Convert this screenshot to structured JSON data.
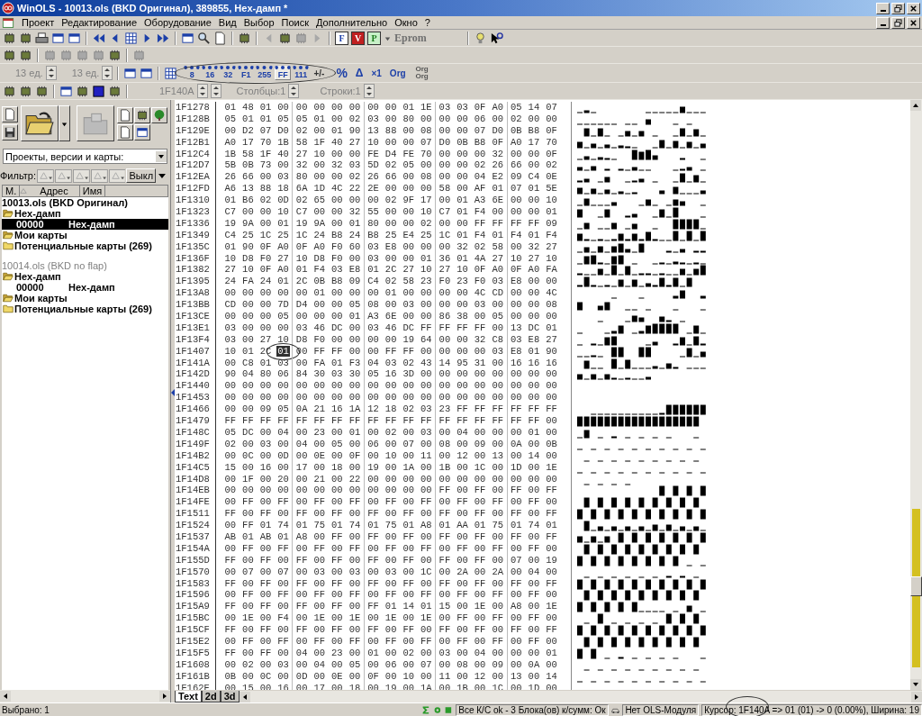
{
  "window": {
    "title": "WinOLS - 10013.ols (BKD Оригинал), 389855, Hex-дамп *"
  },
  "menu": [
    "Проект",
    "Редактирование",
    "Оборудование",
    "Вид",
    "Выбор",
    "Поиск",
    "Дополнительно",
    "Окно",
    "?"
  ],
  "toolbar": {
    "version_buttons": [
      "F",
      "V",
      "P"
    ],
    "eprom": "Eprom"
  },
  "format_toolbar": {
    "spinners": [
      "13 ед.",
      "13 ед."
    ],
    "width_buttons": [
      {
        "label": "8",
        "selected": false
      },
      {
        "label": "16",
        "selected": false
      },
      {
        "label": "32",
        "selected": false
      },
      {
        "label": "F1",
        "selected": false
      }
    ],
    "display_buttons": [
      {
        "label": "255",
        "selected": false
      },
      {
        "label": "FF",
        "selected": true
      },
      {
        "label": "111",
        "selected": false
      }
    ],
    "sign_button": "+/-",
    "mode_buttons": [
      "%",
      "Δ",
      "×1",
      "Org"
    ],
    "org_pair": [
      "Org",
      "Org"
    ]
  },
  "position_toolbar": {
    "address": "1F140A",
    "columns": "Столбцы:1",
    "rows": "Строки:1"
  },
  "left_panel": {
    "combo": "Проекты, версии и карты:",
    "filter_label": "Фильтр:",
    "filter_off": "Выкл",
    "columns": [
      "М.",
      "Адрес",
      "Имя"
    ],
    "projects": [
      {
        "name": "10013.ols (BKD Оригинал)",
        "active": true,
        "folders": [
          {
            "name": "Hex-дамп",
            "expanded": true,
            "maps": [
              {
                "address": "00000",
                "name": "Hex-дамп",
                "selected": true
              }
            ]
          },
          {
            "name": "Мои карты",
            "expanded": true
          },
          {
            "name": "Потенциальные карты (269)",
            "expanded": false
          }
        ]
      },
      {
        "name": "10014.ols (BKD no flap)",
        "active": false,
        "folders": [
          {
            "name": "Hex-дамп",
            "expanded": true,
            "maps": [
              {
                "address": "00000",
                "name": "Hex-дамп",
                "selected": false
              }
            ]
          },
          {
            "name": "Мои карты",
            "expanded": true
          },
          {
            "name": "Потенциальные карты (269)",
            "expanded": false
          }
        ]
      }
    ]
  },
  "hex_view": {
    "rows": [
      {
        "address": "1F1278",
        "bytes": [
          "01",
          "48",
          "01",
          "00",
          "00",
          "00",
          "00",
          "00",
          "00",
          "00",
          "01",
          "1E",
          "03",
          "03",
          "0F",
          "A0",
          "05",
          "14",
          "07"
        ]
      },
      {
        "address": "1F128B",
        "bytes": [
          "05",
          "01",
          "01",
          "05",
          "05",
          "01",
          "00",
          "02",
          "03",
          "00",
          "80",
          "00",
          "00",
          "00",
          "06",
          "00",
          "02",
          "00",
          "00"
        ]
      },
      {
        "address": "1F129E",
        "bytes": [
          "00",
          "D2",
          "07",
          "D0",
          "02",
          "00",
          "01",
          "90",
          "13",
          "88",
          "00",
          "08",
          "00",
          "00",
          "07",
          "D0",
          "0B",
          "B8",
          "0F"
        ]
      },
      {
        "address": "1F12B1",
        "bytes": [
          "A0",
          "17",
          "70",
          "1B",
          "58",
          "1F",
          "40",
          "27",
          "10",
          "00",
          "00",
          "07",
          "D0",
          "0B",
          "B8",
          "0F",
          "A0",
          "17",
          "70"
        ]
      },
      {
        "address": "1F12C4",
        "bytes": [
          "1B",
          "58",
          "1F",
          "40",
          "27",
          "10",
          "00",
          "00",
          "FE",
          "D4",
          "FE",
          "70",
          "00",
          "00",
          "00",
          "32",
          "00",
          "00",
          "0F"
        ]
      },
      {
        "address": "1F12D7",
        "bytes": [
          "5B",
          "0B",
          "73",
          "00",
          "32",
          "00",
          "32",
          "03",
          "5D",
          "02",
          "05",
          "00",
          "00",
          "00",
          "02",
          "26",
          "66",
          "00",
          "02"
        ]
      },
      {
        "address": "1F12EA",
        "bytes": [
          "26",
          "66",
          "00",
          "03",
          "80",
          "00",
          "00",
          "02",
          "26",
          "66",
          "00",
          "08",
          "00",
          "00",
          "04",
          "E2",
          "09",
          "C4",
          "0E"
        ]
      },
      {
        "address": "1F12FD",
        "bytes": [
          "A6",
          "13",
          "88",
          "18",
          "6A",
          "1D",
          "4C",
          "22",
          "2E",
          "00",
          "00",
          "00",
          "58",
          "00",
          "AF",
          "01",
          "07",
          "01",
          "5E"
        ]
      },
      {
        "address": "1F1310",
        "bytes": [
          "01",
          "B6",
          "02",
          "0D",
          "02",
          "65",
          "00",
          "00",
          "00",
          "02",
          "9F",
          "17",
          "00",
          "01",
          "A3",
          "6E",
          "00",
          "00",
          "10"
        ]
      },
      {
        "address": "1F1323",
        "bytes": [
          "C7",
          "00",
          "00",
          "10",
          "C7",
          "00",
          "00",
          "32",
          "55",
          "00",
          "00",
          "10",
          "C7",
          "01",
          "F4",
          "00",
          "00",
          "00",
          "01"
        ]
      },
      {
        "address": "1F1336",
        "bytes": [
          "19",
          "9A",
          "00",
          "01",
          "19",
          "9A",
          "00",
          "01",
          "80",
          "00",
          "00",
          "02",
          "00",
          "00",
          "FF",
          "FF",
          "FF",
          "FF",
          "09"
        ]
      },
      {
        "address": "1F1349",
        "bytes": [
          "C4",
          "25",
          "1C",
          "25",
          "1C",
          "24",
          "B8",
          "24",
          "B8",
          "25",
          "E4",
          "25",
          "1C",
          "01",
          "F4",
          "01",
          "F4",
          "01",
          "F4"
        ]
      },
      {
        "address": "1F135C",
        "bytes": [
          "01",
          "90",
          "0F",
          "A0",
          "0F",
          "A0",
          "F0",
          "60",
          "03",
          "E8",
          "00",
          "00",
          "00",
          "32",
          "02",
          "58",
          "00",
          "32",
          "27"
        ]
      },
      {
        "address": "1F136F",
        "bytes": [
          "10",
          "D8",
          "F0",
          "27",
          "10",
          "D8",
          "F0",
          "00",
          "03",
          "00",
          "00",
          "01",
          "36",
          "01",
          "4A",
          "27",
          "10",
          "27",
          "10"
        ]
      },
      {
        "address": "1F1382",
        "bytes": [
          "27",
          "10",
          "0F",
          "A0",
          "01",
          "F4",
          "03",
          "E8",
          "01",
          "2C",
          "27",
          "10",
          "27",
          "10",
          "0F",
          "A0",
          "0F",
          "A0",
          "FA"
        ]
      },
      {
        "address": "1F1395",
        "bytes": [
          "24",
          "FA",
          "24",
          "01",
          "2C",
          "0B",
          "B8",
          "09",
          "C4",
          "02",
          "58",
          "23",
          "F0",
          "23",
          "F0",
          "03",
          "E8",
          "00",
          "00"
        ]
      },
      {
        "address": "1F13A8",
        "bytes": [
          "00",
          "00",
          "00",
          "00",
          "00",
          "01",
          "00",
          "00",
          "00",
          "01",
          "00",
          "00",
          "00",
          "00",
          "4C",
          "CD",
          "00",
          "00",
          "4C"
        ]
      },
      {
        "address": "1F13BB",
        "bytes": [
          "CD",
          "00",
          "00",
          "7D",
          "D4",
          "00",
          "00",
          "05",
          "08",
          "00",
          "03",
          "00",
          "00",
          "00",
          "03",
          "00",
          "00",
          "00",
          "08"
        ]
      },
      {
        "address": "1F13CE",
        "bytes": [
          "00",
          "00",
          "00",
          "05",
          "00",
          "00",
          "00",
          "01",
          "A3",
          "6E",
          "00",
          "00",
          "86",
          "38",
          "00",
          "05",
          "00",
          "00",
          "00"
        ]
      },
      {
        "address": "1F13E1",
        "bytes": [
          "03",
          "00",
          "00",
          "00",
          "03",
          "46",
          "DC",
          "00",
          "03",
          "46",
          "DC",
          "FF",
          "FF",
          "FF",
          "FF",
          "00",
          "13",
          "DC",
          "01"
        ]
      },
      {
        "address": "1F13F4",
        "bytes": [
          "03",
          "00",
          "27",
          "10",
          "D8",
          "F0",
          "00",
          "00",
          "00",
          "00",
          "19",
          "64",
          "00",
          "00",
          "32",
          "C8",
          "03",
          "E8",
          "27"
        ]
      },
      {
        "address": "1F1407",
        "bytes": [
          "10",
          "01",
          "2C",
          {
            "value": "01",
            "selected": true
          },
          "00",
          "FF",
          "FF",
          "00",
          "00",
          "FF",
          "FF",
          "00",
          "00",
          "00",
          "00",
          "03",
          "E8",
          "01",
          "90"
        ]
      },
      {
        "address": "1F141A",
        "bytes": [
          "00",
          "C8",
          "01",
          "03",
          "00",
          "FA",
          "01",
          "F3",
          "04",
          "03",
          "02",
          "43",
          "14",
          "95",
          "31",
          "00",
          "16",
          "16",
          "16"
        ]
      },
      {
        "address": "1F142D",
        "bytes": [
          "90",
          "04",
          "80",
          "06",
          "84",
          "30",
          "03",
          "30",
          "05",
          "16",
          "3D",
          "00",
          "00",
          "00",
          "00",
          "00",
          "00",
          "00",
          "00"
        ]
      },
      {
        "address": "1F1440",
        "bytes": [
          "00",
          "00",
          "00",
          "00",
          "00",
          "00",
          "00",
          "00",
          "00",
          "00",
          "00",
          "00",
          "00",
          "00",
          "00",
          "00",
          "00",
          "00",
          "00"
        ]
      },
      {
        "address": "1F1453",
        "bytes": [
          "00",
          "00",
          "00",
          "00",
          "00",
          "00",
          "00",
          "00",
          "00",
          "00",
          "00",
          "00",
          "00",
          "00",
          "00",
          "00",
          "00",
          "00",
          "00"
        ]
      },
      {
        "address": "1F1466",
        "bytes": [
          "00",
          "00",
          "09",
          "05",
          "0A",
          "21",
          "16",
          "1A",
          "12",
          "18",
          "02",
          "03",
          "23",
          "FF",
          "FF",
          "FF",
          "FF",
          "FF",
          "FF"
        ]
      },
      {
        "address": "1F1479",
        "bytes": [
          "FF",
          "FF",
          "FF",
          "FF",
          "FF",
          "FF",
          "FF",
          "FF",
          "FF",
          "FF",
          "FF",
          "FF",
          "FF",
          "FF",
          "FF",
          "FF",
          "FF",
          "FF",
          "00"
        ]
      },
      {
        "address": "1F148C",
        "bytes": [
          "05",
          "DC",
          "00",
          "04",
          "00",
          "23",
          "00",
          "01",
          "00",
          "02",
          "00",
          "03",
          "00",
          "04",
          "00",
          "00",
          "00",
          "01",
          "00"
        ]
      },
      {
        "address": "1F149F",
        "bytes": [
          "02",
          "00",
          "03",
          "00",
          "04",
          "00",
          "05",
          "00",
          "06",
          "00",
          "07",
          "00",
          "08",
          "00",
          "09",
          "00",
          "0A",
          "00",
          "0B"
        ]
      },
      {
        "address": "1F14B2",
        "bytes": [
          "00",
          "0C",
          "00",
          "0D",
          "00",
          "0E",
          "00",
          "0F",
          "00",
          "10",
          "00",
          "11",
          "00",
          "12",
          "00",
          "13",
          "00",
          "14",
          "00"
        ]
      },
      {
        "address": "1F14C5",
        "bytes": [
          "15",
          "00",
          "16",
          "00",
          "17",
          "00",
          "18",
          "00",
          "19",
          "00",
          "1A",
          "00",
          "1B",
          "00",
          "1C",
          "00",
          "1D",
          "00",
          "1E"
        ]
      },
      {
        "address": "1F14D8",
        "bytes": [
          "00",
          "1F",
          "00",
          "20",
          "00",
          "21",
          "00",
          "22",
          "00",
          "00",
          "00",
          "00",
          "00",
          "00",
          "00",
          "00",
          "00",
          "00",
          "00"
        ]
      },
      {
        "address": "1F14EB",
        "bytes": [
          "00",
          "00",
          "00",
          "00",
          "00",
          "00",
          "00",
          "00",
          "00",
          "00",
          "00",
          "00",
          "FF",
          "00",
          "FF",
          "00",
          "FF",
          "00",
          "FF"
        ]
      },
      {
        "address": "1F14FE",
        "bytes": [
          "00",
          "FF",
          "00",
          "FF",
          "00",
          "FF",
          "00",
          "FF",
          "00",
          "FF",
          "00",
          "FF",
          "00",
          "FF",
          "00",
          "FF",
          "00",
          "FF",
          "00"
        ]
      },
      {
        "address": "1F1511",
        "bytes": [
          "FF",
          "00",
          "FF",
          "00",
          "FF",
          "00",
          "FF",
          "00",
          "FF",
          "00",
          "FF",
          "00",
          "FF",
          "00",
          "FF",
          "00",
          "FF",
          "00",
          "FF"
        ]
      },
      {
        "address": "1F1524",
        "bytes": [
          "00",
          "FF",
          "01",
          "74",
          "01",
          "75",
          "01",
          "74",
          "01",
          "75",
          "01",
          "A8",
          "01",
          "AA",
          "01",
          "75",
          "01",
          "74",
          "01"
        ]
      },
      {
        "address": "1F1537",
        "bytes": [
          "AB",
          "01",
          "AB",
          "01",
          "A8",
          "00",
          "FF",
          "00",
          "FF",
          "00",
          "FF",
          "00",
          "FF",
          "00",
          "FF",
          "00",
          "FF",
          "00",
          "FF"
        ]
      },
      {
        "address": "1F154A",
        "bytes": [
          "00",
          "FF",
          "00",
          "FF",
          "00",
          "FF",
          "00",
          "FF",
          "00",
          "FF",
          "00",
          "FF",
          "00",
          "FF",
          "00",
          "FF",
          "00",
          "FF",
          "00"
        ]
      },
      {
        "address": "1F155D",
        "bytes": [
          "FF",
          "00",
          "FF",
          "00",
          "FF",
          "00",
          "FF",
          "00",
          "FF",
          "00",
          "FF",
          "00",
          "FF",
          "00",
          "FF",
          "00",
          "07",
          "00",
          "19"
        ]
      },
      {
        "address": "1F1570",
        "bytes": [
          "00",
          "07",
          "00",
          "07",
          "00",
          "03",
          "00",
          "03",
          "00",
          "03",
          "00",
          "1C",
          "00",
          "2A",
          "00",
          "2A",
          "00",
          "04",
          "00"
        ]
      },
      {
        "address": "1F1583",
        "bytes": [
          "FF",
          "00",
          "FF",
          "00",
          "FF",
          "00",
          "FF",
          "00",
          "FF",
          "00",
          "FF",
          "00",
          "FF",
          "00",
          "FF",
          "00",
          "FF",
          "00",
          "FF"
        ]
      },
      {
        "address": "1F1596",
        "bytes": [
          "00",
          "FF",
          "00",
          "FF",
          "00",
          "FF",
          "00",
          "FF",
          "00",
          "FF",
          "00",
          "FF",
          "00",
          "FF",
          "00",
          "FF",
          "00",
          "FF",
          "00"
        ]
      },
      {
        "address": "1F15A9",
        "bytes": [
          "FF",
          "00",
          "FF",
          "00",
          "FF",
          "00",
          "FF",
          "00",
          "FF",
          "01",
          "14",
          "01",
          "15",
          "00",
          "1E",
          "00",
          "A8",
          "00",
          "1E"
        ]
      },
      {
        "address": "1F15BC",
        "bytes": [
          "00",
          "1E",
          "00",
          "F4",
          "00",
          "1E",
          "00",
          "1E",
          "00",
          "1E",
          "00",
          "1E",
          "00",
          "FF",
          "00",
          "FF",
          "00",
          "FF",
          "00"
        ]
      },
      {
        "address": "1F15CF",
        "bytes": [
          "FF",
          "00",
          "FF",
          "00",
          "FF",
          "00",
          "FF",
          "00",
          "FF",
          "00",
          "FF",
          "00",
          "FF",
          "00",
          "FF",
          "00",
          "FF",
          "00",
          "FF"
        ]
      },
      {
        "address": "1F15E2",
        "bytes": [
          "00",
          "FF",
          "00",
          "FF",
          "00",
          "FF",
          "00",
          "FF",
          "00",
          "FF",
          "00",
          "FF",
          "00",
          "FF",
          "00",
          "FF",
          "00",
          "FF",
          "00"
        ]
      },
      {
        "address": "1F15F5",
        "bytes": [
          "FF",
          "00",
          "FF",
          "00",
          "04",
          "00",
          "23",
          "00",
          "01",
          "00",
          "02",
          "00",
          "03",
          "00",
          "04",
          "00",
          "00",
          "00",
          "01"
        ]
      },
      {
        "address": "1F1608",
        "bytes": [
          "00",
          "02",
          "00",
          "03",
          "00",
          "04",
          "00",
          "05",
          "00",
          "06",
          "00",
          "07",
          "00",
          "08",
          "00",
          "09",
          "00",
          "0A",
          "00"
        ]
      },
      {
        "address": "1F161B",
        "bytes": [
          "0B",
          "00",
          "0C",
          "00",
          "0D",
          "00",
          "0E",
          "00",
          "0F",
          "00",
          "10",
          "00",
          "11",
          "00",
          "12",
          "00",
          "13",
          "00",
          "14"
        ]
      },
      {
        "address": "1F162E",
        "bytes": [
          "00",
          "15",
          "00",
          "16",
          "00",
          "17",
          "00",
          "18",
          "00",
          "19",
          "00",
          "1A",
          "00",
          "1B",
          "00",
          "1C",
          "00",
          "1D",
          "00"
        ]
      }
    ]
  },
  "tabs": [
    {
      "label": "Text",
      "selected": true
    },
    {
      "label": "2d",
      "selected": false
    },
    {
      "label": "3d",
      "selected": false
    }
  ],
  "status_bar": {
    "selection": "Выбрано: 1",
    "checksum": "Все К/С ok - 3 Блока(ов) к/сумм: Ок",
    "module": "Нет OLS-Модуля",
    "cursor": "Курсор: 1F140A => 01 (01) -> 0 (0.00%), Ширина: 19"
  }
}
